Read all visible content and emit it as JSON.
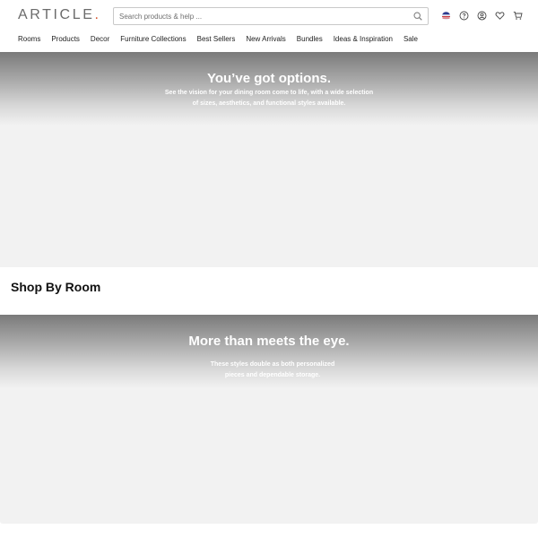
{
  "brand": {
    "logo_text": "ARTICLE",
    "logo_dot": ".",
    "accent_color": "#d8532b"
  },
  "search": {
    "placeholder": "Search products & help ...",
    "icon": "search-icon"
  },
  "utilities": [
    {
      "name": "locale-flag-icon",
      "icon": "flag"
    },
    {
      "name": "help-icon",
      "icon": "question-circle"
    },
    {
      "name": "account-icon",
      "icon": "user-circle"
    },
    {
      "name": "wishlist-icon",
      "icon": "heart"
    },
    {
      "name": "cart-icon",
      "icon": "cart"
    }
  ],
  "nav": {
    "items": [
      "Rooms",
      "Products",
      "Decor",
      "Furniture Collections",
      "Best Sellers",
      "New Arrivals",
      "Bundles",
      "Ideas & Inspiration",
      "Sale"
    ]
  },
  "hero_dining": {
    "title": "You’ve got options.",
    "line1": "See the vision for your dining room come to life, with a wide selection",
    "line2": "of sizes, aesthetics, and functional styles available."
  },
  "shop_by_room": {
    "title": "Shop By Room"
  },
  "hero_storage": {
    "title": "More than meets the eye.",
    "line1": "These styles double as both personalized",
    "line2": "pieces and dependable storage."
  }
}
